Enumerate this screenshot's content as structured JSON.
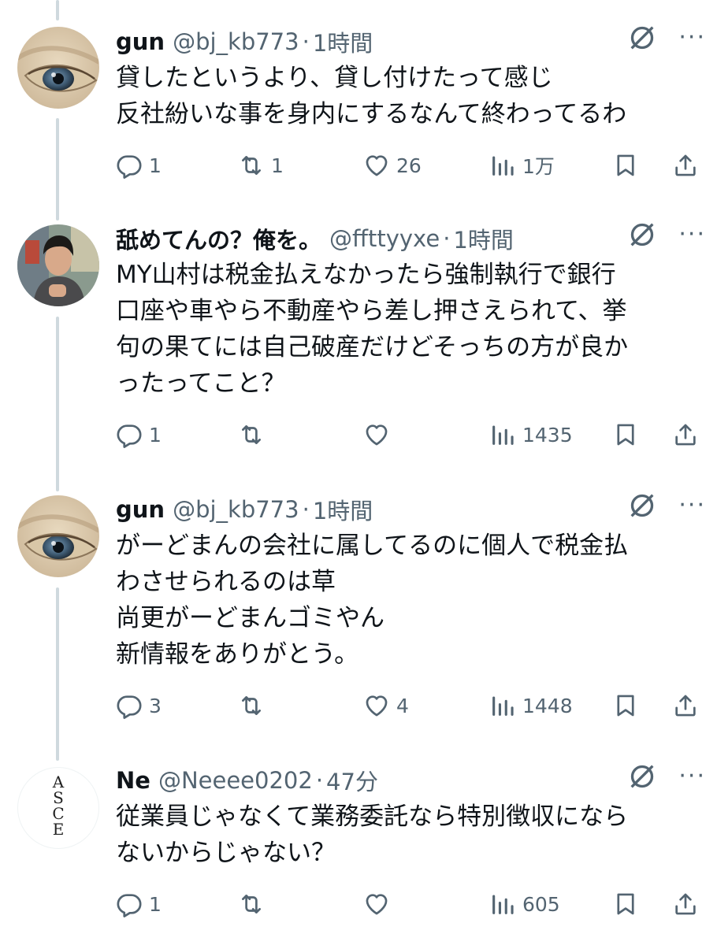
{
  "colors": {
    "text": "#0f1419",
    "secondary": "#536471",
    "thread_line": "#cfd9de"
  },
  "tweets": [
    {
      "name": "gun",
      "handle": "@bj_kb773",
      "separator": "·",
      "time": "1時間",
      "text": "貸したというより、貸し付けたって感じ\n反社紛いな事を身内にするなんて終わってるわ",
      "avatar_icon": "eye-closeup-avatar",
      "replies": "1",
      "reposts": "1",
      "likes": "26",
      "views": "1万"
    },
    {
      "name": "舐めてんの？俺を。",
      "handle": "@ffttyyxe",
      "separator": "·",
      "time": "1時間",
      "text": "MY山村は税金払えなかったら強制執行で銀行\n口座や車やら不動産やら差し押さえられて、挙\n句の果てには自己破産だけどそっちの方が良か\nったってこと？",
      "avatar_icon": "person-photo-avatar",
      "replies": "1",
      "reposts": "",
      "likes": "",
      "views": "1435"
    },
    {
      "name": "gun",
      "handle": "@bj_kb773",
      "separator": "·",
      "time": "1時間",
      "text": "がーどまんの会社に属してるのに個人で税金払\nわさせられるのは草\n尚更がーどまんゴミやん\n新情報をありがとう。",
      "avatar_icon": "eye-closeup-avatar",
      "replies": "3",
      "reposts": "",
      "likes": "4",
      "views": "1448"
    },
    {
      "name": "Ne",
      "handle": "@Neeee0202",
      "separator": "·",
      "time": "47分",
      "text": "従業員じゃなくて業務委託なら特別徴収になら\nないからじゃない？",
      "avatar_icon": "asce-logo-avatar",
      "avatar_letters": [
        "A",
        "S",
        "C",
        "E"
      ],
      "replies": "1",
      "reposts": "",
      "likes": "",
      "views": "605"
    }
  ]
}
